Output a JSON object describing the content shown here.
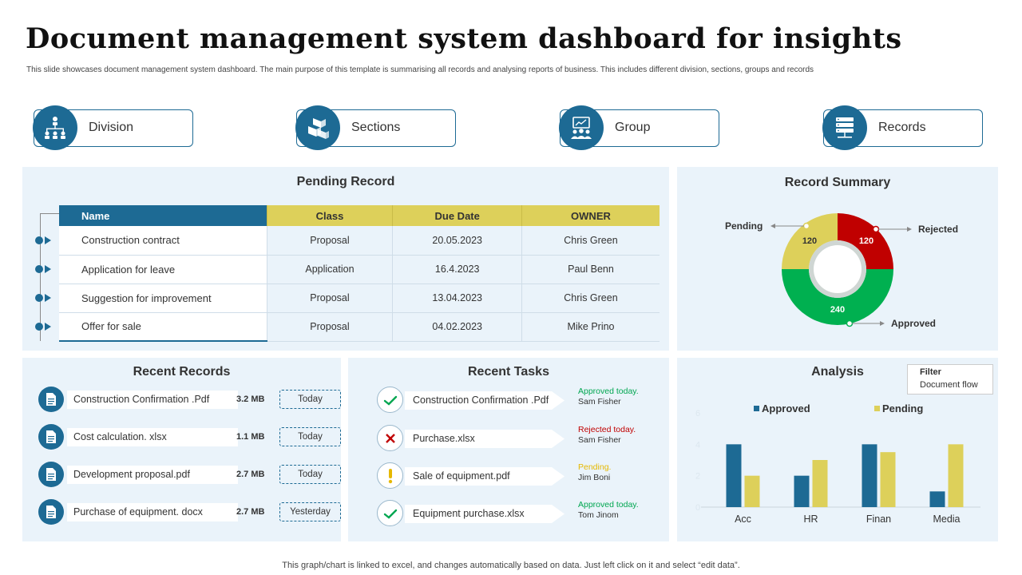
{
  "header": {
    "title": "Document management system dashboard for insights",
    "subtitle": "This slide showcases document management system dashboard. The main purpose of this template is summarising all records and analysing reports of business. This includes different division, sections, groups and records"
  },
  "categories": [
    {
      "label": "Division",
      "icon": "org-chart-icon"
    },
    {
      "label": "Sections",
      "icon": "boxes-icon"
    },
    {
      "label": "Group",
      "icon": "group-presentation-icon"
    },
    {
      "label": "Records",
      "icon": "server-rack-icon"
    }
  ],
  "pending": {
    "title": "Pending Record",
    "headers": [
      "Name",
      "Class",
      "Due Date",
      "OWNER"
    ],
    "rows": [
      {
        "name": "Construction contract",
        "class": "Proposal",
        "due": "20.05.2023",
        "owner": "Chris Green"
      },
      {
        "name": "Application for leave",
        "class": "Application",
        "due": "16.4.2023",
        "owner": "Paul Benn"
      },
      {
        "name": "Suggestion for improvement",
        "class": "Proposal",
        "due": "13.04.2023",
        "owner": "Chris Green"
      },
      {
        "name": "Offer for sale",
        "class": "Proposal",
        "due": "04.02.2023",
        "owner": "Mike Prino"
      }
    ]
  },
  "summary": {
    "title": "Record Summary",
    "segments": [
      {
        "label": "Rejected",
        "value": 120,
        "color": "#c00000"
      },
      {
        "label": "Approved",
        "value": 240,
        "color": "#00b050"
      },
      {
        "label": "Pending",
        "value": 120,
        "color": "#ddd05a"
      }
    ]
  },
  "recent_records": {
    "title": "Recent Records",
    "items": [
      {
        "name": "Construction Confirmation .Pdf",
        "size": "3.2 MB",
        "when": "Today"
      },
      {
        "name": "Cost calculation. xlsx",
        "size": "1.1 MB",
        "when": "Today"
      },
      {
        "name": "Development proposal.pdf",
        "size": "2.7 MB",
        "when": "Today"
      },
      {
        "name": "Purchase of equipment. docx",
        "size": "2.7 MB",
        "when": "Yesterday"
      }
    ]
  },
  "recent_tasks": {
    "title": "Recent Tasks",
    "items": [
      {
        "name": "Construction Confirmation .Pdf",
        "status": "Approved today.",
        "status_color": "#00a650",
        "who": "Sam Fisher",
        "icon": "check-icon"
      },
      {
        "name": "Purchase.xlsx",
        "status": "Rejected today.",
        "status_color": "#c00000",
        "who": "Sam Fisher",
        "icon": "cross-icon"
      },
      {
        "name": "Sale of equipment.pdf",
        "status": "Pending.",
        "status_color": "#e6b800",
        "who": "Jim Boni",
        "icon": "exclamation-icon"
      },
      {
        "name": "Equipment purchase.xlsx",
        "status": "Approved today.",
        "status_color": "#00a650",
        "who": "Tom Jinom",
        "icon": "check-icon"
      }
    ]
  },
  "analysis": {
    "title": "Analysis",
    "filter_label": "Filter",
    "filter_value": "Document flow"
  },
  "chart_data": {
    "type": "bar",
    "categories": [
      "Acc",
      "HR",
      "Finan",
      "Media"
    ],
    "series": [
      {
        "name": "Approved",
        "values": [
          4,
          2,
          4,
          1
        ],
        "color": "#1d6a94"
      },
      {
        "name": "Pending",
        "values": [
          2,
          3,
          3.5,
          4
        ],
        "color": "#ddd05a"
      }
    ],
    "yticks": [
      0,
      2,
      4,
      6
    ],
    "ylim": [
      0,
      6
    ],
    "legend": "top"
  },
  "footnote": "This graph/chart is linked to excel,  and changes automatically based on data. Just left click on it and select “edit data”."
}
